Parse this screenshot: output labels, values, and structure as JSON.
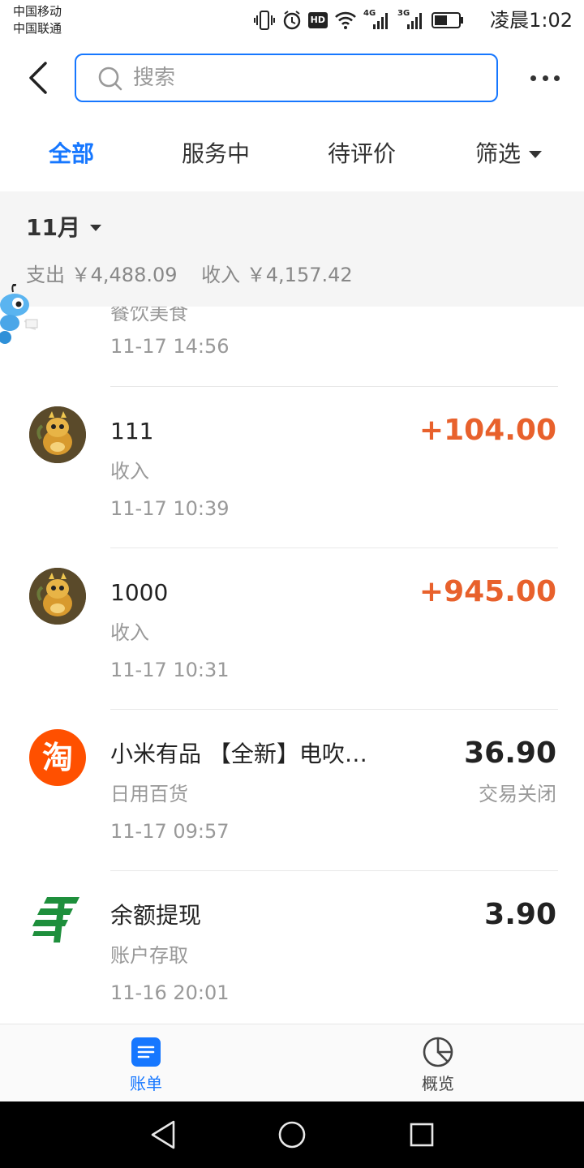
{
  "status_bar": {
    "carrier1": "中国移动",
    "carrier2": "中国联通",
    "time": "凌晨1:02",
    "icons": [
      "vibrate-icon",
      "alarm-icon",
      "hd-icon",
      "wifi-icon",
      "signal-4g-icon",
      "signal-3g-icon",
      "battery-icon"
    ],
    "hd_text": "HD",
    "net1": "4G",
    "net2": "3G"
  },
  "header": {
    "search_placeholder": "搜索"
  },
  "tabs": {
    "items": [
      "全部",
      "服务中",
      "待评价"
    ],
    "active_index": 0,
    "filter_label": "筛选"
  },
  "month": {
    "label": "11月",
    "expense": "支出 ￥4,488.09",
    "income": "收入 ￥4,157.42"
  },
  "records": [
    {
      "title": "",
      "category": "餐饮美食",
      "time": "11-17  14:56",
      "amount": "",
      "status": ""
    },
    {
      "title": "111",
      "category": "收入",
      "time": "11-17  10:39",
      "amount": "+104.00",
      "status": "",
      "avatar_icon": "dragon-avatar-icon"
    },
    {
      "title": "1000",
      "category": "收入",
      "time": "11-17  10:31",
      "amount": "+945.00",
      "status": "",
      "avatar_icon": "dragon-avatar-icon"
    },
    {
      "title": "小米有品 【全新】电吹…",
      "category": "日用百货",
      "time": "11-17  09:57",
      "amount": "36.90",
      "status": "交易关闭",
      "avatar_icon": "taobao-icon",
      "avatar_glyph": "淘"
    },
    {
      "title": "余额提现",
      "category": "账户存取",
      "time": "11-16  20:01",
      "amount": "3.90",
      "status": "",
      "avatar_icon": "postal-bank-icon"
    }
  ],
  "bottom_nav": {
    "items": [
      {
        "label": "账单",
        "icon": "bill-icon"
      },
      {
        "label": "概览",
        "icon": "pie-chart-icon"
      }
    ],
    "active_index": 0
  },
  "colors": {
    "accent": "#1677ff",
    "income": "#e8612c",
    "taobao": "#ff5000",
    "postal": "#1e8f3c"
  }
}
